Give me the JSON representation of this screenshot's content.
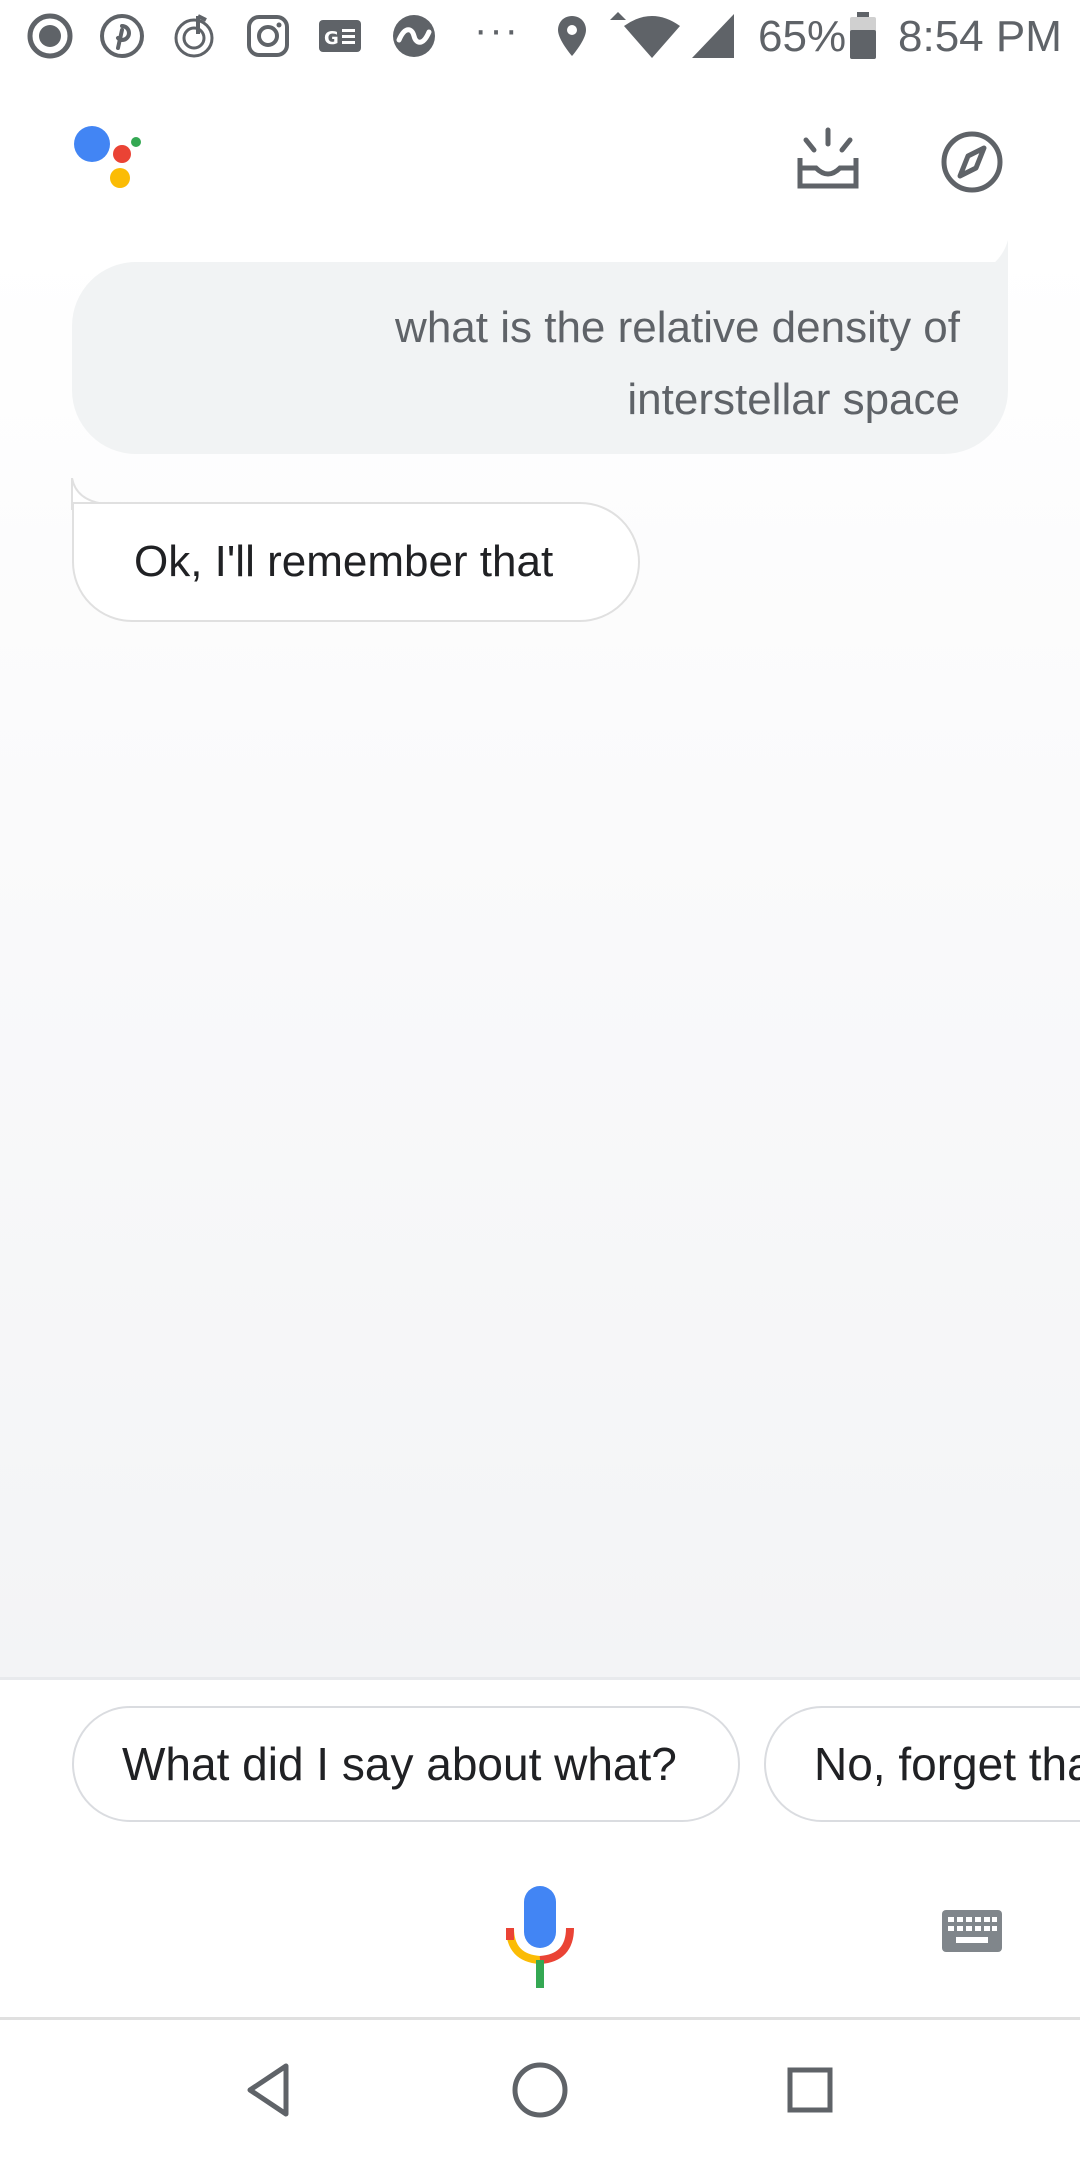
{
  "status_bar": {
    "notification_icons": [
      "aperture-icon",
      "pinterest-icon",
      "music-note-icon",
      "instagram-icon",
      "ge-icon",
      "tidal-wave-icon"
    ],
    "overflow": "···",
    "battery_percent": "65%",
    "time": "8:54 PM"
  },
  "header": {
    "logo": "google-assistant-logo",
    "updates_icon": "snapshot-tray-icon",
    "explore_icon": "compass-icon"
  },
  "conversation": {
    "user_query": "what is the relative density of interstellar space",
    "user_query_line1": "what is the relative density of",
    "user_query_line2": "interstellar space",
    "assistant_reply": "Ok, I'll remember that"
  },
  "suggestions": [
    {
      "label": "What did I say about what?"
    },
    {
      "label": "No, forget that"
    }
  ],
  "input": {
    "mic_icon": "mic-icon",
    "keyboard_icon": "keyboard-icon"
  },
  "navigation": [
    "back-icon",
    "home-icon",
    "recents-icon"
  ],
  "colors": {
    "google_blue": "#4285F4",
    "google_red": "#EA4335",
    "google_yellow": "#FBBC05",
    "google_green": "#34A853",
    "icon_grey": "#5f6368"
  }
}
